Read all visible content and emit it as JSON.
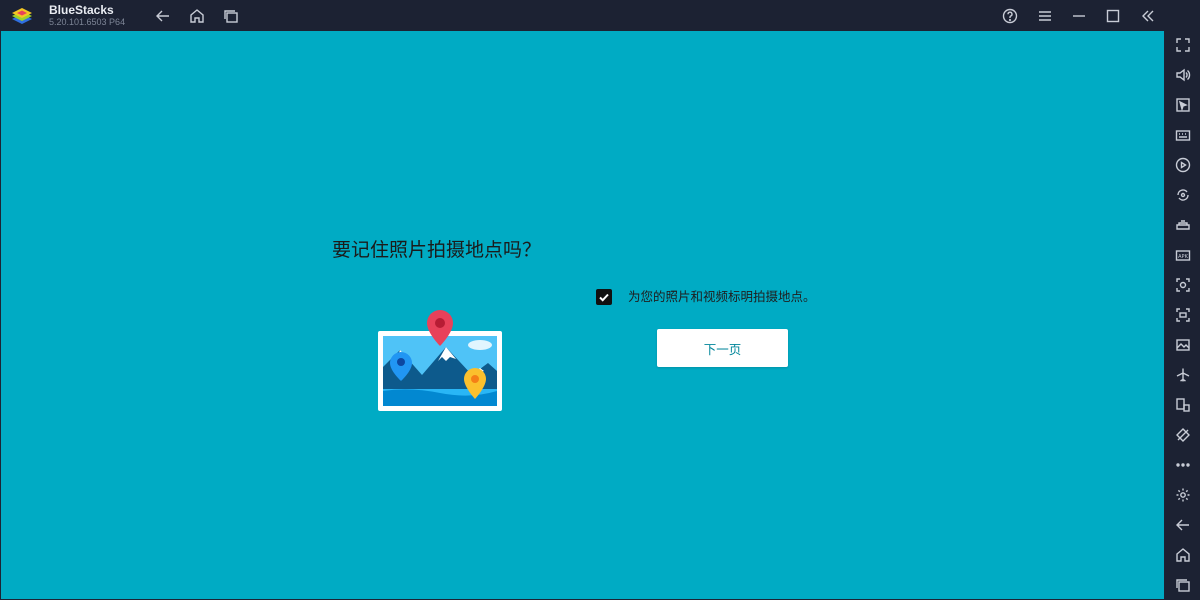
{
  "titlebar": {
    "app_name": "BlueStacks",
    "version": "5.20.101.6503 P64",
    "nav": [
      "back-icon",
      "home-icon",
      "recent-apps-icon"
    ],
    "controls": [
      "help-icon",
      "menu-icon",
      "minimize-icon",
      "maximize-icon",
      "collapse-sidebar-icon"
    ]
  },
  "main": {
    "heading": "要记住照片拍摄地点吗？",
    "checkbox_checked": true,
    "checkbox_label": "为您的照片和视频标明拍摄地点。",
    "next_button_label": "下一页"
  },
  "sidebar": {
    "icons": [
      "fullscreen-icon",
      "volume-icon",
      "pointer-icon",
      "keyboard-icon",
      "media-icon",
      "rotate-icon",
      "game-controls-icon",
      "apk-icon",
      "screenshot-icon",
      "screen-record-icon",
      "media-folder-icon",
      "airplane-icon",
      "multi-instance-icon",
      "eco-mode-icon",
      "more-icon",
      "settings-icon",
      "android-back-icon",
      "android-home-icon",
      "android-recent-icon"
    ],
    "apk_label": "APK"
  },
  "colors": {
    "content_bg": "#00abc4",
    "chrome_bg": "#1c2233",
    "button_text": "#00869a",
    "pin_red": "#e8415a",
    "pin_blue": "#2196f3",
    "pin_yellow": "#fbc02d"
  }
}
